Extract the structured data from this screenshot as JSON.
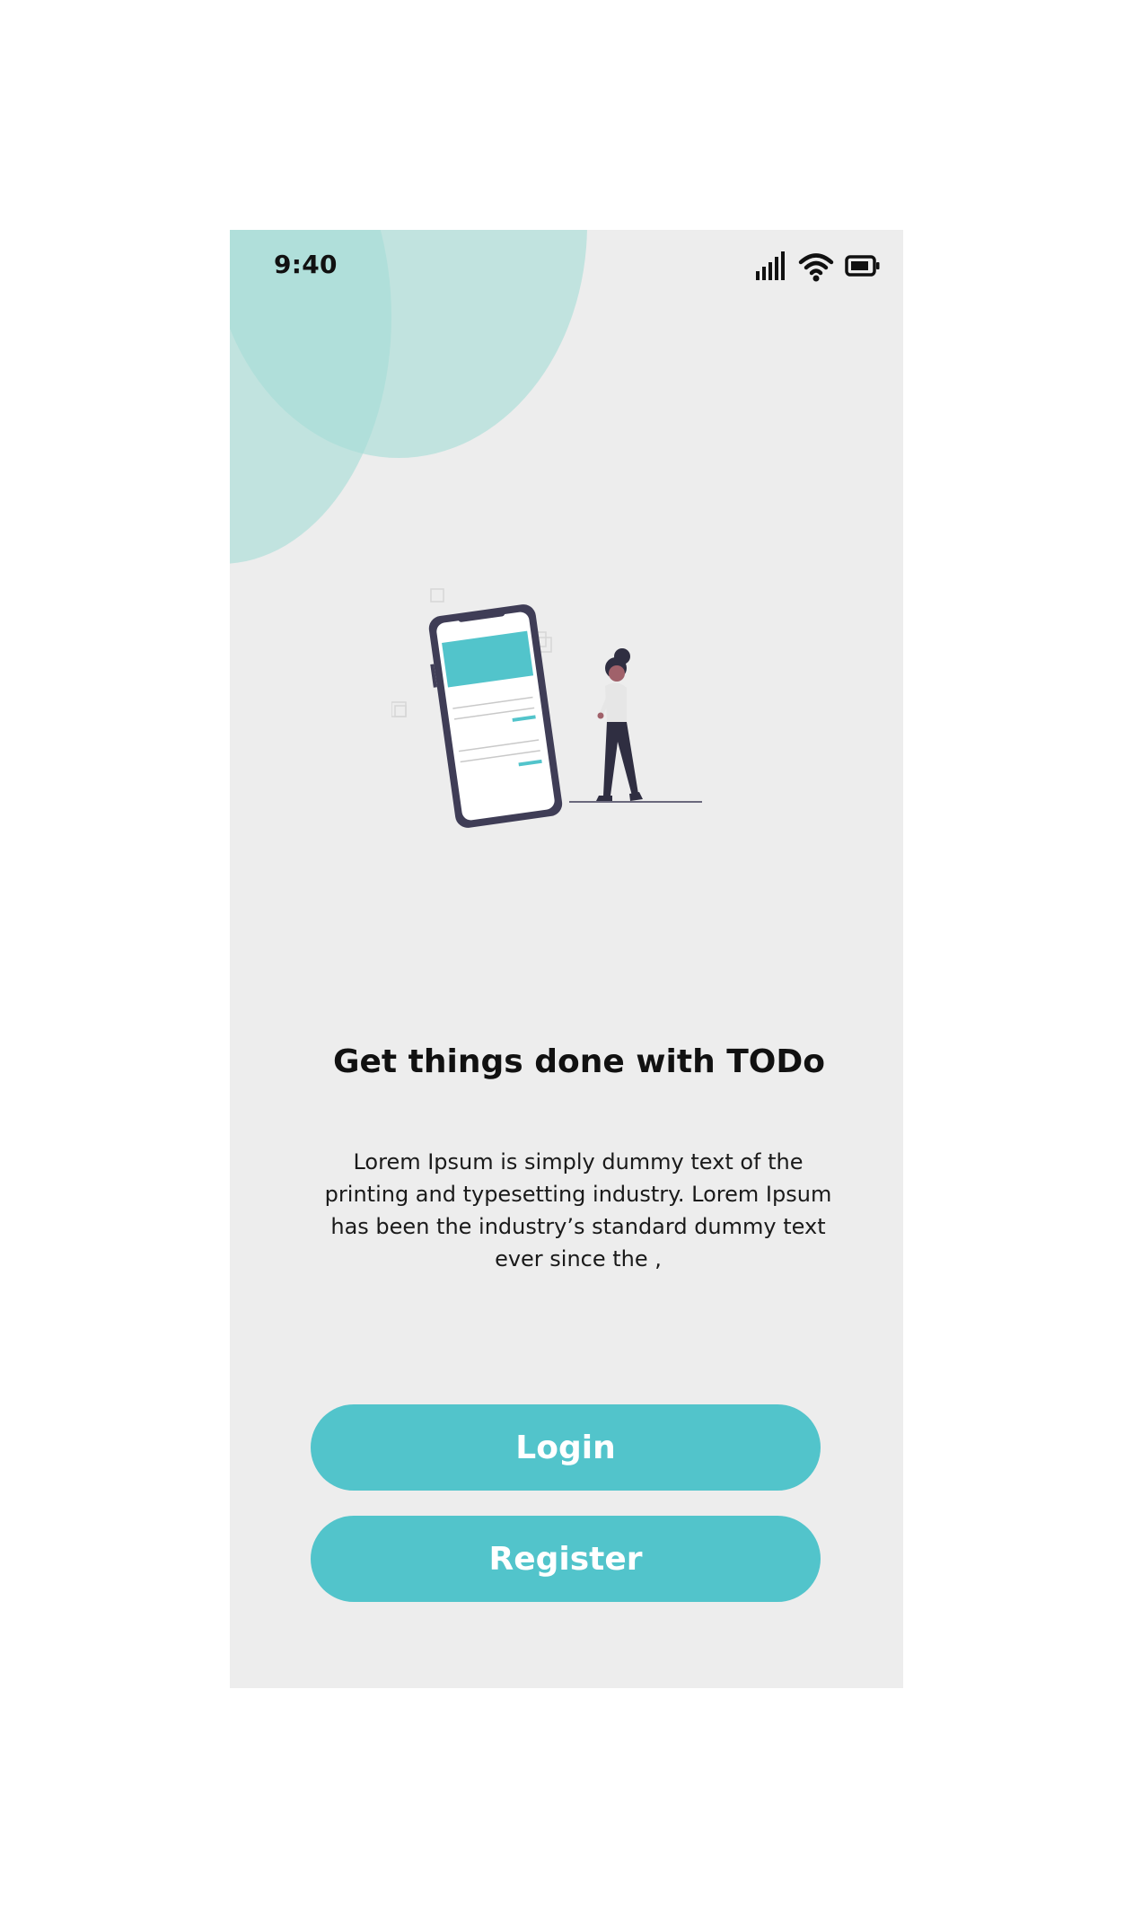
{
  "status_bar": {
    "time": "9:40",
    "icons": [
      "cellular-signal-icon",
      "wifi-icon",
      "battery-icon"
    ]
  },
  "welcome": {
    "headline": "Get things done with TODo",
    "description": "Lorem Ipsum is simply dummy text of the printing and typesetting industry. Lorem Ipsum has been the industry’s standard dummy text ever since the ,"
  },
  "actions": {
    "login_label": "Login",
    "register_label": "Register"
  },
  "colors": {
    "background": "#EDEDED",
    "accent": "#52C4CB",
    "blob": "#A6DDD6",
    "ink": "#3F3D56"
  }
}
